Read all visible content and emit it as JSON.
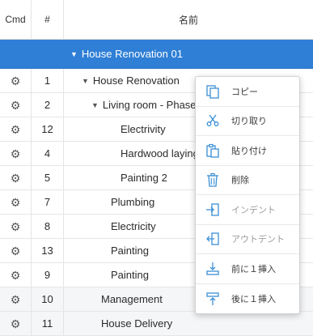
{
  "header": {
    "cmd": "Cmd",
    "num": "#",
    "name": "名前"
  },
  "group_row": {
    "name": "House Renovation 01"
  },
  "rows": [
    {
      "num": "1",
      "name": "House Renovation",
      "caret": "▼"
    },
    {
      "num": "2",
      "name": "Living room - Phase",
      "caret": "▼"
    },
    {
      "num": "12",
      "name": "Electrivity",
      "caret": ""
    },
    {
      "num": "4",
      "name": "Hardwood laying",
      "caret": ""
    },
    {
      "num": "5",
      "name": "Painting 2",
      "caret": ""
    },
    {
      "num": "7",
      "name": "Plumbing",
      "caret": ""
    },
    {
      "num": "8",
      "name": "Electricity",
      "caret": ""
    },
    {
      "num": "13",
      "name": "Painting",
      "caret": ""
    },
    {
      "num": "9",
      "name": "Painting",
      "caret": ""
    },
    {
      "num": "10",
      "name": "Management",
      "caret": ""
    },
    {
      "num": "11",
      "name": "House Delivery",
      "caret": ""
    }
  ],
  "context_menu": {
    "items": [
      {
        "label": "コピー",
        "icon": "copy-icon",
        "enabled": true
      },
      {
        "label": "切り取り",
        "icon": "cut-icon",
        "enabled": true
      },
      {
        "label": "貼り付け",
        "icon": "paste-icon",
        "enabled": true
      },
      {
        "label": "削除",
        "icon": "delete-icon",
        "enabled": true
      },
      {
        "label": "インデント",
        "icon": "indent-icon",
        "enabled": false
      },
      {
        "label": "アウトデント",
        "icon": "outdent-icon",
        "enabled": false
      },
      {
        "label": "前に１挿入",
        "icon": "insert-before-icon",
        "enabled": true
      },
      {
        "label": "後に１挿入",
        "icon": "insert-after-icon",
        "enabled": true
      }
    ]
  },
  "colors": {
    "accent": "#2f7fd6",
    "icon": "#3b8fd6"
  },
  "icons": {
    "cmd": "gear-icon",
    "expand": "caret-down-icon"
  }
}
